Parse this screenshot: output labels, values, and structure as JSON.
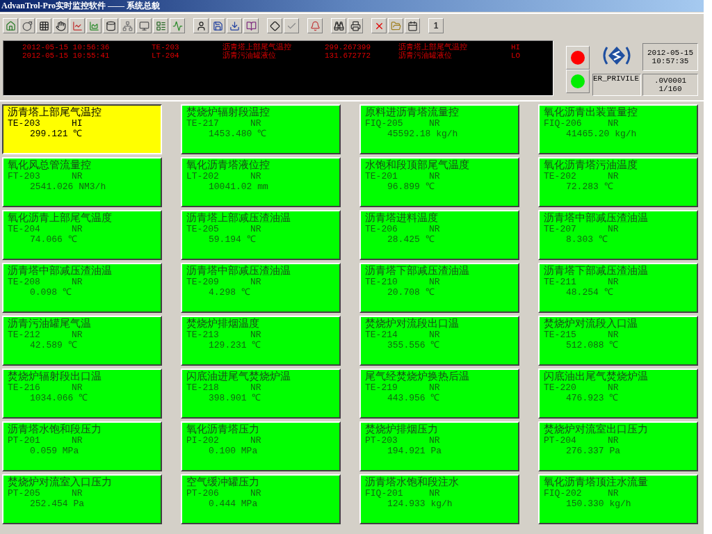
{
  "window": {
    "title": "AdvanTrol-Pro实时监控软件 —— 系统总貌"
  },
  "toolbar": {
    "page_button": "1"
  },
  "alarms": [
    {
      "time": "2012-05-15 10:56:36",
      "tag": "TE-203",
      "description": "沥青塔上部尾气温控",
      "value": "299.267399",
      "description_2": "沥青塔上部尾气温控",
      "status": "HI"
    },
    {
      "time": "2012-05-15 10:55:41",
      "tag": "LT-204",
      "description": "沥青污油罐液位",
      "value": "131.672772",
      "description_2": "沥青污油罐液位",
      "status": "LO"
    }
  ],
  "info_panel": {
    "date": "2012-05-15",
    "time": "10:57:35",
    "user": "ER_PRIVILE",
    "operator": ".0V0001",
    "page": "1/160"
  },
  "points": [
    {
      "name": "沥青塔上部尾气温控",
      "tag": "TE-203",
      "status": "HI",
      "value": "299.121 ℃",
      "alarm": true
    },
    {
      "name": "焚烧炉辐射段温控",
      "tag": "TE-217",
      "status": "NR",
      "value": "1453.480 ℃",
      "alarm": false
    },
    {
      "name": "原料进沥青塔流量控",
      "tag": "FIQ-205",
      "status": "NR",
      "value": "45592.18 kg/h",
      "alarm": false
    },
    {
      "name": "氧化沥青出装置量控",
      "tag": "FIQ-206",
      "status": "NR",
      "value": "41465.20 kg/h",
      "alarm": false
    },
    {
      "name": "氧化风总管流量控",
      "tag": "FT-203",
      "status": "NR",
      "value": "2541.026 NM3/h",
      "alarm": false
    },
    {
      "name": "氧化沥青塔液位控",
      "tag": "LT-202",
      "status": "NR",
      "value": "10041.02 mm",
      "alarm": false
    },
    {
      "name": "水饱和段顶部尾气温度",
      "tag": "TE-201",
      "status": "NR",
      "value": "96.899 ℃",
      "alarm": false
    },
    {
      "name": "氧化沥青塔污油温度",
      "tag": "TE-202",
      "status": "NR",
      "value": "72.283 ℃",
      "alarm": false
    },
    {
      "name": "氧化沥青上部尾气温度",
      "tag": "TE-204",
      "status": "NR",
      "value": "74.066 ℃",
      "alarm": false
    },
    {
      "name": "沥青塔上部减压渣油温",
      "tag": "TE-205",
      "status": "NR",
      "value": "59.194 ℃",
      "alarm": false
    },
    {
      "name": "沥青塔进料温度",
      "tag": "TE-206",
      "status": "NR",
      "value": "28.425 ℃",
      "alarm": false
    },
    {
      "name": "沥青塔中部减压渣油温",
      "tag": "TE-207",
      "status": "NR",
      "value": "8.303 ℃",
      "alarm": false
    },
    {
      "name": "沥青塔中部减压渣油温",
      "tag": "TE-208",
      "status": "NR",
      "value": "0.098 ℃",
      "alarm": false
    },
    {
      "name": "沥青塔中部减压渣油温",
      "tag": "TE-209",
      "status": "NR",
      "value": "4.298 ℃",
      "alarm": false
    },
    {
      "name": "沥青塔下部减压渣油温",
      "tag": "TE-210",
      "status": "NR",
      "value": "20.708 ℃",
      "alarm": false
    },
    {
      "name": "沥青塔下部减压渣油温",
      "tag": "TE-211",
      "status": "NR",
      "value": "48.254 ℃",
      "alarm": false
    },
    {
      "name": "沥青污油罐尾气温",
      "tag": "TE-212",
      "status": "NR",
      "value": "42.589 ℃",
      "alarm": false
    },
    {
      "name": "焚烧炉排烟温度",
      "tag": "TE-213",
      "status": "NR",
      "value": "129.231 ℃",
      "alarm": false
    },
    {
      "name": "焚烧炉对流段出口温",
      "tag": "TE-214",
      "status": "NR",
      "value": "355.556 ℃",
      "alarm": false
    },
    {
      "name": "焚烧炉对流段入口温",
      "tag": "TE-215",
      "status": "NR",
      "value": "512.088 ℃",
      "alarm": false
    },
    {
      "name": "焚烧炉辐射段出口温",
      "tag": "TE-216",
      "status": "NR",
      "value": "1034.066 ℃",
      "alarm": false
    },
    {
      "name": "闪底油进尾气焚烧炉温",
      "tag": "TE-218",
      "status": "NR",
      "value": "398.901 ℃",
      "alarm": false
    },
    {
      "name": "尾气经焚烧炉换热后温",
      "tag": "TE-219",
      "status": "NR",
      "value": "443.956 ℃",
      "alarm": false
    },
    {
      "name": "闪底油出尾气焚烧炉温",
      "tag": "TE-220",
      "status": "NR",
      "value": "476.923 ℃",
      "alarm": false
    },
    {
      "name": "沥青塔水饱和段压力",
      "tag": "PT-201",
      "status": "NR",
      "value": "0.059 MPa",
      "alarm": false
    },
    {
      "name": "氧化沥青塔压力",
      "tag": "PI-202",
      "status": "NR",
      "value": "0.100 MPa",
      "alarm": false
    },
    {
      "name": "焚烧炉排烟压力",
      "tag": "PT-203",
      "status": "NR",
      "value": "194.921 Pa",
      "alarm": false
    },
    {
      "name": "焚烧炉对流室出口压力",
      "tag": "PT-204",
      "status": "NR",
      "value": "276.337 Pa",
      "alarm": false
    },
    {
      "name": "焚烧炉对流室入口压力",
      "tag": "PT-205",
      "status": "NR",
      "value": "252.454 Pa",
      "alarm": false
    },
    {
      "name": "空气缓冲罐压力",
      "tag": "PT-206",
      "status": "NR",
      "value": "0.444 MPa",
      "alarm": false
    },
    {
      "name": "沥青塔水饱和段注水",
      "tag": "FIQ-201",
      "status": "NR",
      "value": "124.933 kg/h",
      "alarm": false
    },
    {
      "name": "氧化沥青塔顶注水流量",
      "tag": "FIQ-202",
      "status": "NR",
      "value": "150.330 kg/h",
      "alarm": false
    }
  ]
}
